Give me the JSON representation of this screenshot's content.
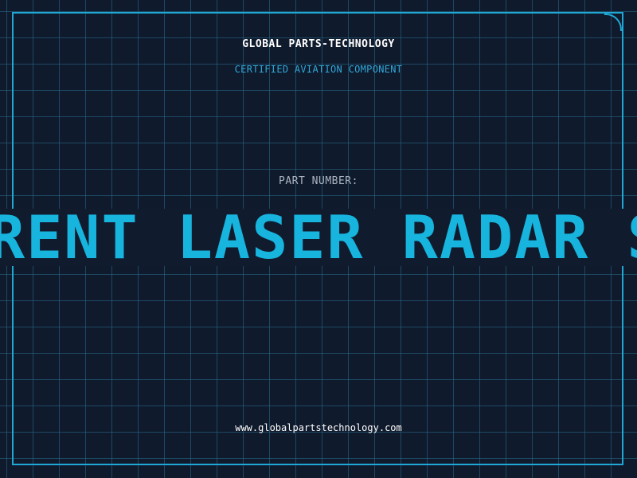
{
  "brand": {
    "name": "GLOBAL PARTS-TECHNOLOGY",
    "tagline": "CERTIFIED AVIATION COMPONENT"
  },
  "part": {
    "label": "PART NUMBER:",
    "number_visible": "RENT LASER RADAR SY"
  },
  "footer": {
    "website": "www.globalpartstechnology.com"
  },
  "colors": {
    "background": "#101a2d",
    "grid": "#286e8c",
    "accent": "#1fa8d4",
    "part_number": "#17b4de"
  }
}
